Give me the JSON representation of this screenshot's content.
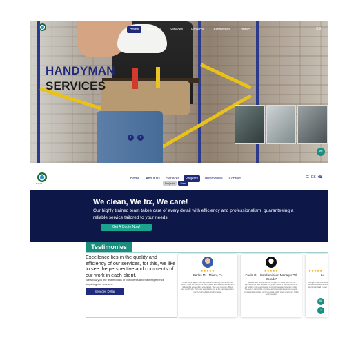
{
  "hero": {
    "title_line1": "HANDYMAN",
    "title_line2": "SERVICES",
    "nav": [
      "Home",
      "About Us",
      "Services",
      "Projects",
      "Testimonies",
      "Contact"
    ],
    "lang": "ES"
  },
  "nav2": {
    "logo_text": "RAM A",
    "links": [
      "Home",
      "About Us",
      "Services",
      "Projects",
      "Testimonies",
      "Contact"
    ],
    "lang": "ES",
    "dropdown": [
      "Projects",
      "Next"
    ]
  },
  "banner": {
    "heading": "We clean, We fix, We care!",
    "text": "Our highly trained team takes care of every detail with efficiency and professionalism, guaranteeing a reliable service tailored to your needs.",
    "button": "Get A Quote Now!"
  },
  "testimonials": {
    "heading": "Testimonies",
    "intro": "Excellence lies in the quality and efficiency of our services, for this, we like to see the perspective and comments of our work in each client.",
    "sub": "We show you the testimonials of our clients and their experience acquiring our services.",
    "button": "Services Detail",
    "cards": [
      {
        "name": "Carlos M. - Miami, FL",
        "stars": "★★★★★",
        "text": "I could not be happier with the professional cleaning and maintenance service. From the first visit the team showed a commitment and attention to detail that exceeded my expectations. They were punctual, efficient and very friendly. The house was spotless and all the repairs were done quickly. I will definitely hire them again."
      },
      {
        "name": "Paola R. - Condominium Manager \"El Dorado\"",
        "stars": "★★★★★",
        "text": "We have been working with this company for over a year and the experience has been excellent. They take care of all the maintenance in our building, from deep cleaning of common areas to preventive repairs. The team is responsible, organized and always attentive to our requests. Communication is clear and they respond quickly to any emergency. Highly recommended."
      },
      {
        "name": "Lu",
        "stars": "★★★★★",
        "text": "Hiring this team was the best decision. Excellent service and attention to detail in every visit."
      }
    ]
  },
  "colors": {
    "navy": "#0d1848",
    "brand_blue": "#1f2b7a",
    "teal": "#1a8f80",
    "star": "#e8a90c"
  }
}
